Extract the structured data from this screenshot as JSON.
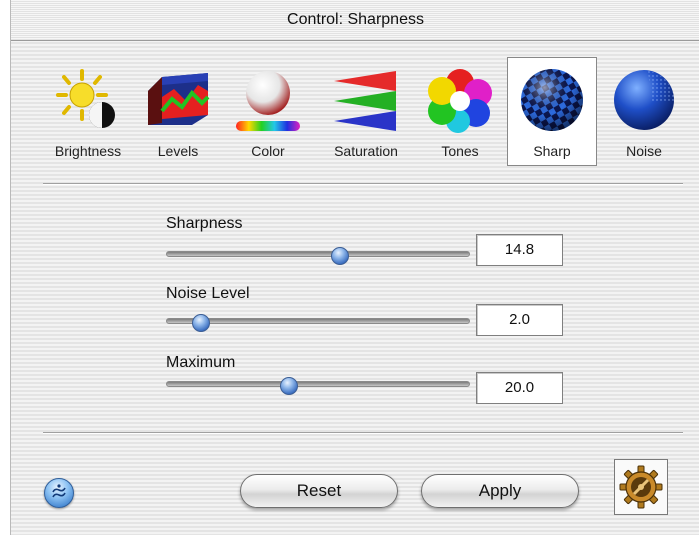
{
  "window": {
    "title": "Control: Sharpness"
  },
  "toolbar": {
    "items": [
      {
        "label": "Brightness",
        "icon": "brightness-icon",
        "selected": false
      },
      {
        "label": "Levels",
        "icon": "levels-icon",
        "selected": false
      },
      {
        "label": "Color",
        "icon": "color-icon",
        "selected": false
      },
      {
        "label": "Saturation",
        "icon": "saturation-icon",
        "selected": false
      },
      {
        "label": "Tones",
        "icon": "tones-icon",
        "selected": false
      },
      {
        "label": "Sharp",
        "icon": "sharp-icon",
        "selected": true
      },
      {
        "label": "Noise",
        "icon": "noise-icon",
        "selected": false
      }
    ]
  },
  "sliders": [
    {
      "label": "Sharpness",
      "value": "14.8",
      "level": 0.57
    },
    {
      "label": "Noise Level",
      "value": "2.0",
      "level": 0.11
    },
    {
      "label": "Maximum",
      "value": "20.0",
      "level": 0.4
    }
  ],
  "buttons": {
    "reset": "Reset",
    "apply": "Apply"
  },
  "icons": {
    "help": "help-icon",
    "settings": "gear-icon"
  },
  "colors": {
    "accent": "#3b6ec0",
    "window_bg": "#f0f0f0"
  }
}
